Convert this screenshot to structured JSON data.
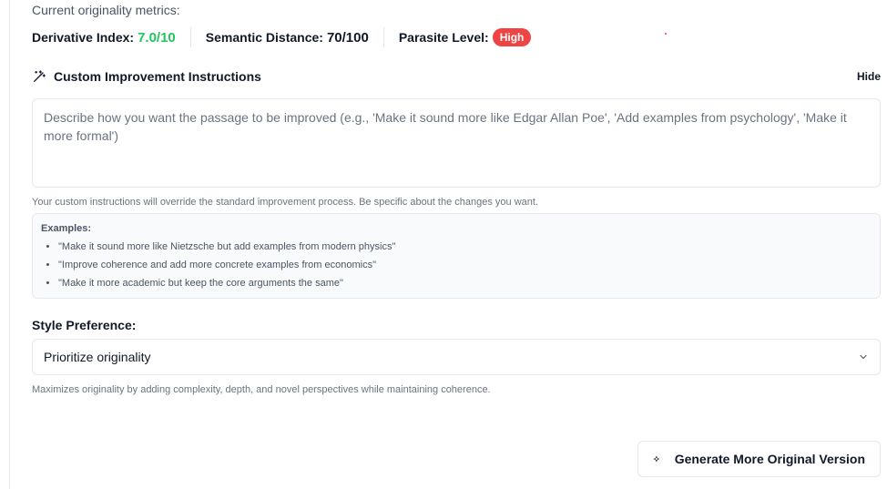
{
  "metrics": {
    "caption": "Current originality metrics:",
    "derivative": {
      "label": "Derivative Index:",
      "value": "7.0/10",
      "color": "#22c55e"
    },
    "semantic": {
      "label": "Semantic Distance:",
      "value": "70/100"
    },
    "parasite": {
      "label": "Parasite Level:",
      "badge": "High",
      "badge_color": "#ef4444"
    }
  },
  "instructions": {
    "icon": "magic-wand-icon",
    "title": "Custom Improvement Instructions",
    "hide_label": "Hide",
    "value": "",
    "placeholder": "Describe how you want the passage to be improved (e.g., 'Make it sound more like Edgar Allan Poe', 'Add examples from psychology', 'Make it more formal')",
    "helper": "Your custom instructions will override the standard improvement process. Be specific about the changes you want."
  },
  "examples": {
    "title": "Examples:",
    "items": [
      "\"Make it sound more like Nietzsche but add examples from modern physics\"",
      "\"Improve coherence and add more concrete examples from economics\"",
      "\"Make it more academic but keep the core arguments the same\""
    ]
  },
  "style": {
    "label": "Style Preference:",
    "selected": "Prioritize originality",
    "chevron_icon": "chevron-down-icon",
    "description": "Maximizes originality by adding complexity, depth, and novel perspectives while maintaining coherence."
  },
  "generate": {
    "icon": "sparkle-icon",
    "label": "Generate More Original Version"
  }
}
